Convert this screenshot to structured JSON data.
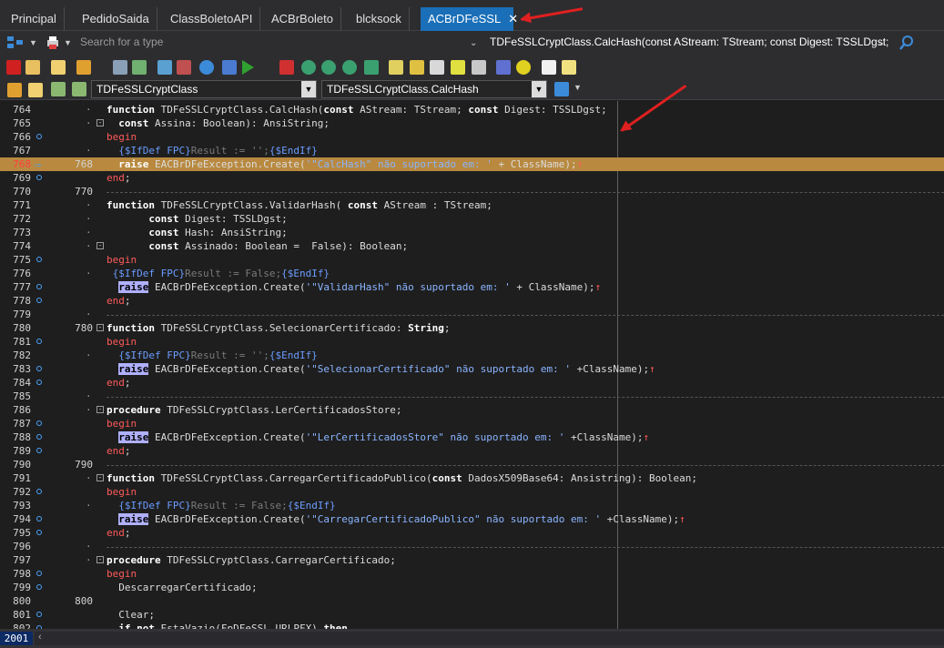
{
  "tabs": [
    {
      "label": "Principal",
      "active": false
    },
    {
      "label": "PedidoSaida",
      "active": false
    },
    {
      "label": "ClassBoletoAPI",
      "active": false
    },
    {
      "label": "ACBrBoleto",
      "active": false
    },
    {
      "label": "blcksock",
      "active": false
    },
    {
      "label": "ACBrDFeSSL",
      "active": true
    }
  ],
  "tab_close_glyph": "✕",
  "search": {
    "placeholder": "Search for a type"
  },
  "locator_text": "TDFeSSLCryptClass.CalcHash(const AStream: TStream; const Digest: TSSLDgst;",
  "class_combo": "TDFeSSLCryptClass",
  "method_combo": "TDFeSSLCryptClass.CalcHash",
  "status": {
    "position": "2001"
  },
  "colors": {
    "accent": "#1a6fb8",
    "exec_line": "#b8893f",
    "annotation_arrow": "#e02020"
  },
  "code_lines": [
    {
      "n": "764",
      "dot": "·",
      "html": "<span class='kw'>function</span> TDFeSSLCryptClass.CalcHash(<span class='kw'>const</span> AStream: TStream; <span class='kw'>const</span> Digest: TSSLDgst;"
    },
    {
      "n": "765",
      "dot": "·",
      "fold": "⊟",
      "html": "  <span class='kw'>const</span> Assina: Boolean): AnsiString;"
    },
    {
      "n": "766",
      "bp": true,
      "html": "<span class='kwr'>begin</span>"
    },
    {
      "n": "767",
      "dot": "·",
      "html": "  <span class='dir'>{$IfDef FPC}</span><span class='cm'>Result := '';</span><span class='dir'>{$EndIf}</span>"
    },
    {
      "n": "768",
      "red": true,
      "ptr": true,
      "mark": "768",
      "exec": true,
      "html": "  <span class='kw'>raise</span> EACBrDFeException.Create(<span class='str'>'\"CalcHash\" não suportado em: '</span> + ClassName);<span class='kwr'>↑</span>"
    },
    {
      "n": "769",
      "bp": true,
      "html": "<span class='kwr'>end</span>;"
    },
    {
      "n": "770",
      "mark": "770",
      "sep": true,
      "html": ""
    },
    {
      "n": "771",
      "dot": "·",
      "html": "<span class='kw'>function</span> TDFeSSLCryptClass.ValidarHash( <span class='kw'>const</span> AStream : TStream;"
    },
    {
      "n": "772",
      "dot": "·",
      "html": "       <span class='kw'>const</span> Digest: TSSLDgst;"
    },
    {
      "n": "773",
      "dot": "·",
      "html": "       <span class='kw'>const</span> Hash: AnsiString;"
    },
    {
      "n": "774",
      "dot": "·",
      "fold": "⊟",
      "html": "       <span class='kw'>const</span> Assinado: Boolean =  False): Boolean;"
    },
    {
      "n": "775",
      "bp": true,
      "html": "<span class='kwr'>begin</span>"
    },
    {
      "n": "776",
      "dot": "·",
      "html": " <span class='dir'>{$IfDef FPC}</span><span class='cm'>Result := False;</span><span class='dir'>{$EndIf}</span>"
    },
    {
      "n": "777",
      "bp": true,
      "html": "  <span class='hl'>raise</span> EACBrDFeException.Create(<span class='str'>'\"ValidarHash\" não suportado em: '</span> + ClassName);<span class='kwr'>↑</span>"
    },
    {
      "n": "778",
      "bp": true,
      "html": "<span class='kwr'>end</span>;"
    },
    {
      "n": "779",
      "dot": "·",
      "sep": true,
      "html": ""
    },
    {
      "n": "780",
      "mark": "780",
      "fold": "⊟",
      "html": "<span class='kw'>function</span> TDFeSSLCryptClass.SelecionarCertificado: <span class='kw'>String</span>;"
    },
    {
      "n": "781",
      "bp": true,
      "html": "<span class='kwr'>begin</span>"
    },
    {
      "n": "782",
      "dot": "·",
      "html": "  <span class='dir'>{$IfDef FPC}</span><span class='cm'>Result := '';</span><span class='dir'>{$EndIf}</span>"
    },
    {
      "n": "783",
      "bp": true,
      "html": "  <span class='hl'>raise</span> EACBrDFeException.Create(<span class='str'>'\"SelecionarCertificado\" não suportado em: '</span> +ClassName);<span class='kwr'>↑</span>"
    },
    {
      "n": "784",
      "bp": true,
      "html": "<span class='kwr'>end</span>;"
    },
    {
      "n": "785",
      "dot": "·",
      "sep": true,
      "html": ""
    },
    {
      "n": "786",
      "dot": "·",
      "fold": "⊟",
      "html": "<span class='kw'>procedure</span> TDFeSSLCryptClass.LerCertificadosStore;"
    },
    {
      "n": "787",
      "bp": true,
      "html": "<span class='kwr'>begin</span>"
    },
    {
      "n": "788",
      "bp": true,
      "html": "  <span class='hl'>raise</span> EACBrDFeException.Create(<span class='str'>'\"LerCertificadosStore\" não suportado em: '</span> +ClassName);<span class='kwr'>↑</span>"
    },
    {
      "n": "789",
      "bp": true,
      "html": "<span class='kwr'>end</span>;"
    },
    {
      "n": "790",
      "mark": "790",
      "sep": true,
      "html": ""
    },
    {
      "n": "791",
      "dot": "·",
      "fold": "⊟",
      "html": "<span class='kw'>function</span> TDFeSSLCryptClass.CarregarCertificadoPublico(<span class='kw'>const</span> DadosX509Base64: Ansistring): Boolean;"
    },
    {
      "n": "792",
      "bp": true,
      "html": "<span class='kwr'>begin</span>"
    },
    {
      "n": "793",
      "dot": "·",
      "html": "  <span class='dir'>{$IfDef FPC}</span><span class='cm'>Result := False;</span><span class='dir'>{$EndIf}</span>"
    },
    {
      "n": "794",
      "bp": true,
      "html": "  <span class='hl'>raise</span> EACBrDFeException.Create(<span class='str'>'\"CarregarCertificadoPublico\" não suportado em: '</span> +ClassName);<span class='kwr'>↑</span>"
    },
    {
      "n": "795",
      "bp": true,
      "html": "<span class='kwr'>end</span>;"
    },
    {
      "n": "796",
      "dot": "·",
      "sep": true,
      "html": ""
    },
    {
      "n": "797",
      "dot": "·",
      "fold": "⊟",
      "html": "<span class='kw'>procedure</span> TDFeSSLCryptClass.CarregarCertificado;"
    },
    {
      "n": "798",
      "bp": true,
      "html": "<span class='kwr'>begin</span>"
    },
    {
      "n": "799",
      "bp": true,
      "html": "  DescarregarCertificado;"
    },
    {
      "n": "800",
      "mark": "800",
      "html": ""
    },
    {
      "n": "801",
      "bp": true,
      "html": "  Clear;"
    },
    {
      "n": "802",
      "bp": true,
      "html": "  <span class='kw'>if not</span> EstaVazio(FpDFeSSL.URLPFX) <span class='kw'>then</span>"
    }
  ]
}
